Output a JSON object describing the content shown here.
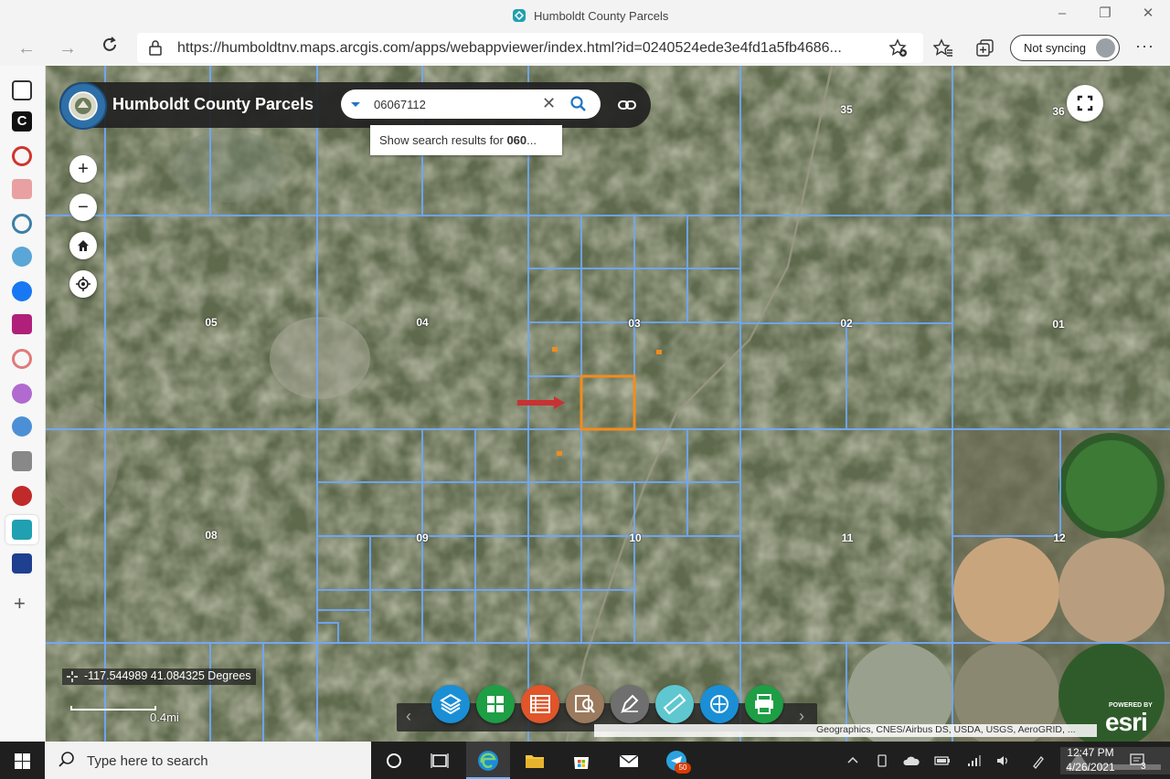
{
  "window": {
    "title": "Humboldt County Parcels"
  },
  "browser": {
    "url": "https://humboldtnv.maps.arcgis.com/apps/webappviewer/index.html?id=0240524ede3e4fd1a5fb4686...",
    "sync_label": "Not syncing",
    "more_label": "···"
  },
  "app": {
    "title": "Humboldt County Parcels",
    "search": {
      "value": "06067112",
      "placeholder": "",
      "clear_label": "✕"
    },
    "suggestion": {
      "prefix": "Show search results for ",
      "bold": "060",
      "suffix": "..."
    },
    "zoom_in_label": "+",
    "zoom_out_label": "−",
    "coordinates": "-117.544989 41.084325 Degrees",
    "scale": "0.4mi",
    "attribution": "Geographics, CNES/Airbus DS, USDA, USGS, AeroGRID, ...",
    "esri": {
      "powered": "POWERED BY",
      "word": "esri"
    },
    "sections": [
      {
        "label": "35"
      },
      {
        "label": "36"
      },
      {
        "label": "05"
      },
      {
        "label": "04"
      },
      {
        "label": "03"
      },
      {
        "label": "02"
      },
      {
        "label": "01"
      },
      {
        "label": "08"
      },
      {
        "label": "09"
      },
      {
        "label": "10"
      },
      {
        "label": "11"
      },
      {
        "label": "12"
      }
    ],
    "tools": [
      {
        "name": "layers",
        "color": "#1a8fd6"
      },
      {
        "name": "basemap",
        "color": "#1e9e45"
      },
      {
        "name": "attribute-table",
        "color": "#e0552a"
      },
      {
        "name": "query",
        "color": "#9b7a5e"
      },
      {
        "name": "draw",
        "color": "#6f6f6f"
      },
      {
        "name": "measurement",
        "color": "#5fc7cf"
      },
      {
        "name": "swipe",
        "color": "#1a8fd6"
      },
      {
        "name": "print",
        "color": "#1e9e45"
      }
    ],
    "colors": {
      "parcel_line": "#6ea8ff",
      "highlight": "#f28c1e",
      "arrow": "#c83232"
    }
  },
  "taskbar": {
    "search_text": "Type here to search",
    "telegram_badge": "50",
    "time": "12:47 PM",
    "date": "4/26/2021",
    "notifications": "3"
  }
}
